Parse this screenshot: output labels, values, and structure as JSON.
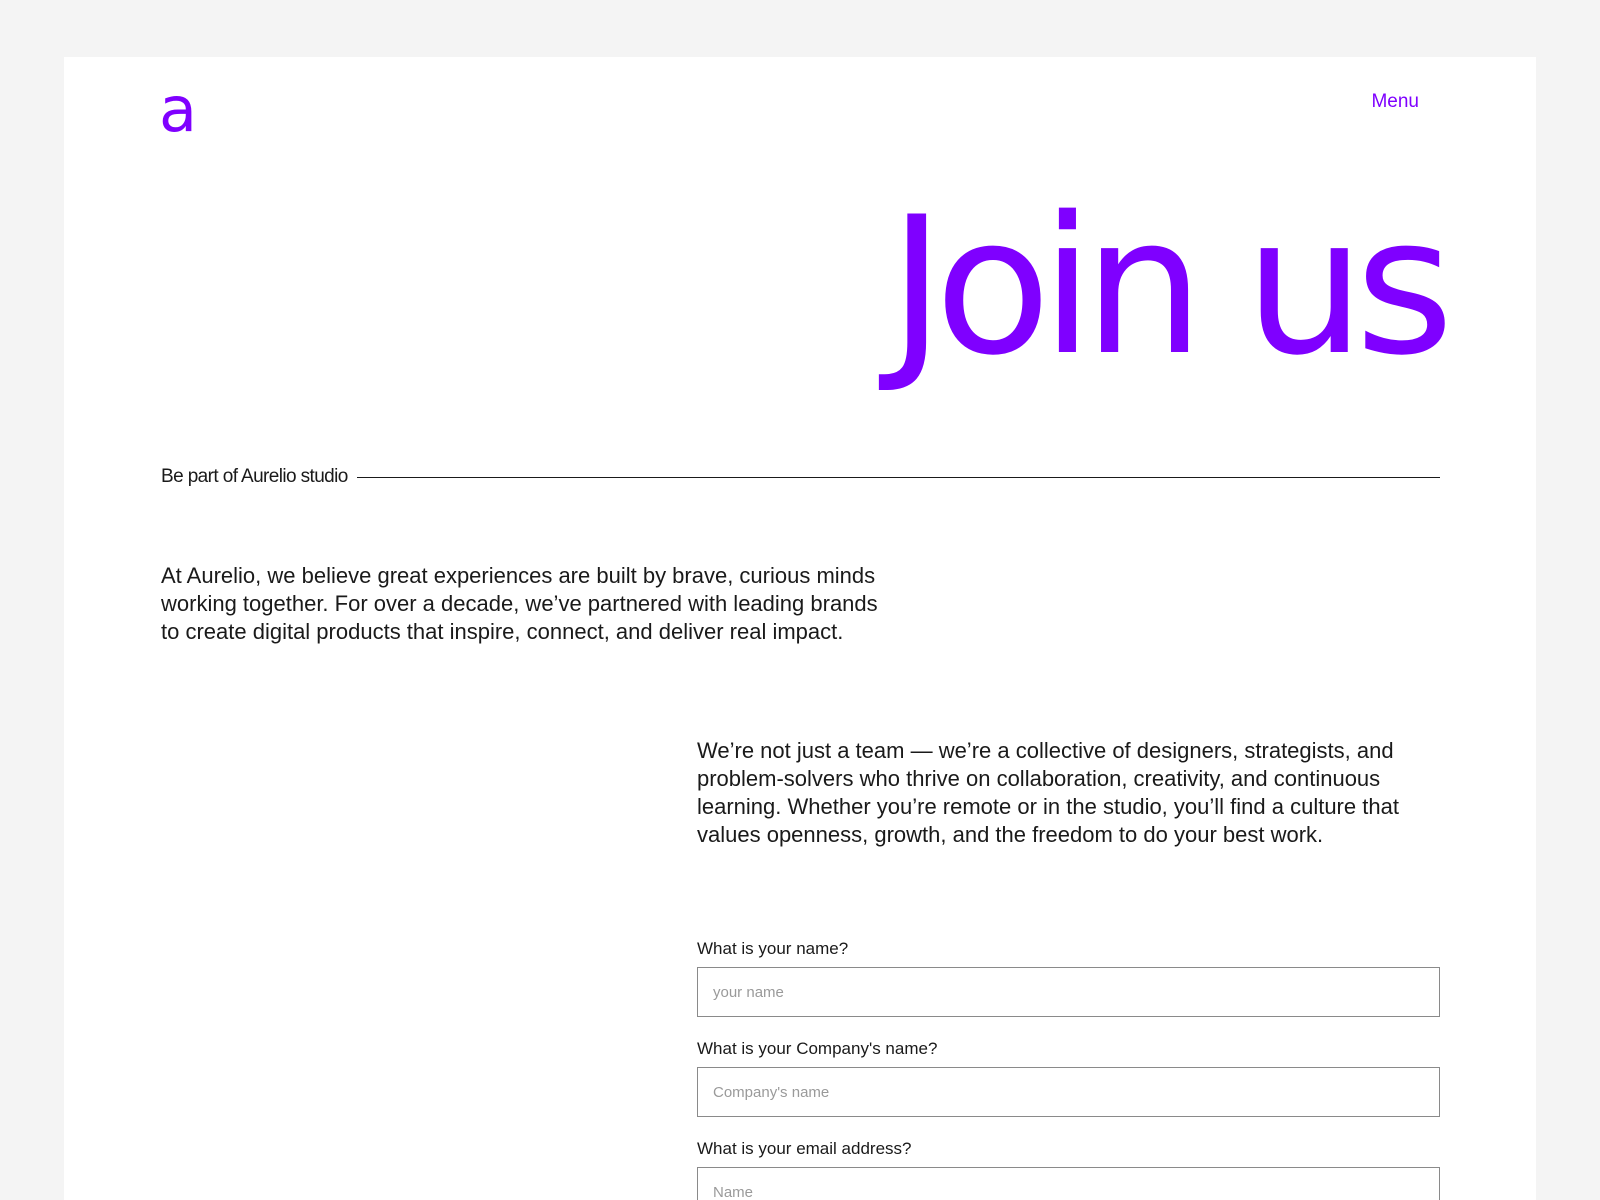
{
  "brand": {
    "logo_text": "a",
    "accent_color": "#7f00ff"
  },
  "header": {
    "menu_label": "Menu"
  },
  "hero": {
    "title": "Join us"
  },
  "section": {
    "label": "Be part of Aurelio studio"
  },
  "content": {
    "intro": "At Aurelio, we believe great experiences are built by brave, curious minds working together. For over a decade, we’ve partnered with leading brands to create digital products that inspire, connect, and deliver real impact.",
    "culture": "We’re not just a team — we’re a collective of designers, strategists, and problem-solvers who thrive on collaboration, creativity, and continuous learning. Whether you’re remote or in the studio, you’ll find a culture that values openness, growth, and the freedom to do your best work."
  },
  "form": {
    "fields": [
      {
        "label": "What is your name?",
        "placeholder": "your name",
        "value": ""
      },
      {
        "label": "What is your Company's name?",
        "placeholder": "Company's name",
        "value": ""
      },
      {
        "label": "What is your email address?",
        "placeholder": "Name",
        "value": ""
      }
    ]
  }
}
